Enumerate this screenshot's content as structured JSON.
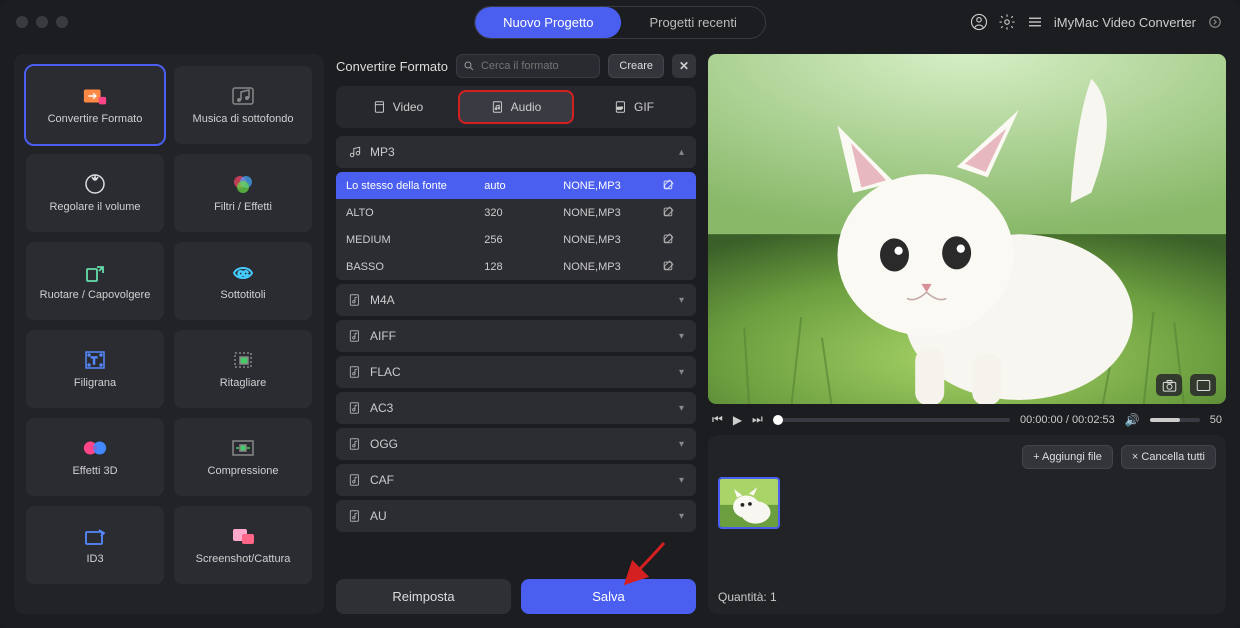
{
  "titlebar": {
    "tabs": {
      "new": "Nuovo Progetto",
      "recent": "Progetti recenti"
    },
    "app_name": "iMyMac Video Converter"
  },
  "sidebar": {
    "tools": [
      {
        "id": "convert",
        "label": "Convertire Formato",
        "active": true
      },
      {
        "id": "bgmusic",
        "label": "Musica di sottofondo",
        "active": false
      },
      {
        "id": "volume",
        "label": "Regolare il volume",
        "active": false
      },
      {
        "id": "filters",
        "label": "Filtri / Effetti",
        "active": false
      },
      {
        "id": "rotate",
        "label": "Ruotare / Capovolgere",
        "active": false
      },
      {
        "id": "subtitle",
        "label": "Sottotitoli",
        "active": false
      },
      {
        "id": "watermark",
        "label": "Filigrana",
        "active": false
      },
      {
        "id": "crop",
        "label": "Ritagliare",
        "active": false
      },
      {
        "id": "3d",
        "label": "Effetti 3D",
        "active": false
      },
      {
        "id": "compress",
        "label": "Compressione",
        "active": false
      },
      {
        "id": "id3",
        "label": "ID3",
        "active": false
      },
      {
        "id": "screenshot",
        "label": "Screenshot/Cattura",
        "active": false
      }
    ]
  },
  "middle": {
    "title": "Convertire Formato",
    "search_placeholder": "Cerca il formato",
    "create": "Creare",
    "tabs": {
      "video": "Video",
      "audio": "Audio",
      "gif": "GIF",
      "active": "audio"
    },
    "expanded_group": "MP3",
    "presets": [
      {
        "name": "Lo stesso della fonte",
        "bitrate": "auto",
        "codec": "NONE,MP3",
        "selected": true
      },
      {
        "name": "ALTO",
        "bitrate": "320",
        "codec": "NONE,MP3",
        "selected": false
      },
      {
        "name": "MEDIUM",
        "bitrate": "256",
        "codec": "NONE,MP3",
        "selected": false
      },
      {
        "name": "BASSO",
        "bitrate": "128",
        "codec": "NONE,MP3",
        "selected": false
      }
    ],
    "collapsed_groups": [
      "M4A",
      "AIFF",
      "FLAC",
      "AC3",
      "OGG",
      "CAF",
      "AU"
    ],
    "reset": "Reimposta",
    "save": "Salva"
  },
  "player": {
    "time_current": "00:00:00",
    "time_total": "00:02:53",
    "volume_value": "50"
  },
  "files": {
    "add": "Aggiungi file",
    "clear": "Cancella tutti",
    "quantity_label": "Quantità:",
    "quantity_value": "1"
  }
}
